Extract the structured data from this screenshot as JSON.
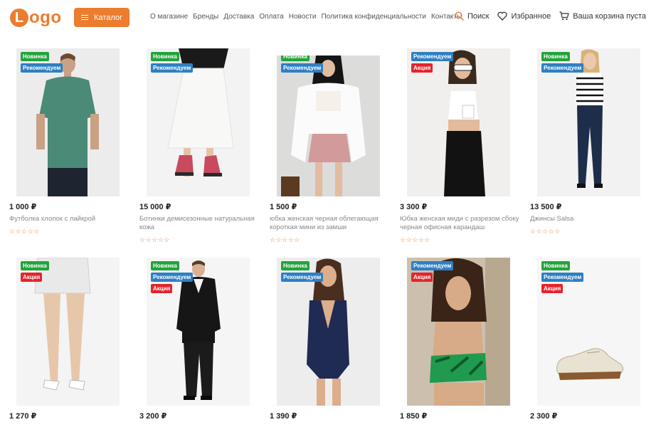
{
  "header": {
    "logo_letter": "L",
    "logo_rest": "ogo",
    "catalog_label": "Каталог",
    "nav": [
      "О магазине",
      "Бренды",
      "Доставка",
      "Оплата",
      "Новости",
      "Политика конфиденциальности",
      "Контакты"
    ],
    "search_label": "Поиск",
    "favorites_label": "Избранное",
    "cart_label": "Ваша корзина пуста"
  },
  "colors": {
    "accent": "#ec7c2e",
    "badge_new": "#22a33a",
    "badge_recommended": "#2e7fc4",
    "badge_sale": "#e5242b"
  },
  "rating_stars": "☆☆☆☆☆",
  "products": [
    {
      "price": "1 000 ₽",
      "name": "Футболка хлопок с лайкрой",
      "badges": [
        "Новинка",
        "Рекомендуем"
      ],
      "image": "man-green-tshirt"
    },
    {
      "price": "15 000 ₽",
      "name": "Ботинки демисезонные натуральная кожа",
      "badges": [
        "Новинка",
        "Рекомендуем"
      ],
      "image": "white-skirt-pink-boots"
    },
    {
      "price": "1 500 ₽",
      "name": "юбка женская черная облегающая короткая мини из замши",
      "badges": [
        "Новинка",
        "Рекомендуем"
      ],
      "image": "woman-white-blazer"
    },
    {
      "price": "3 300 ₽",
      "name": "Юбка женская миди с разрезом сбоку черная офисная карандаш",
      "badges": [
        "Рекомендуем",
        "Акция"
      ],
      "image": "woman-black-skirt"
    },
    {
      "price": "13 500 ₽",
      "name": "Джинсы Salsa",
      "badges": [
        "Новинка",
        "Рекомендуем"
      ],
      "image": "woman-jeans"
    },
    {
      "price": "1 270 ₽",
      "name": "",
      "badges": [
        "Новинка",
        "Акция"
      ],
      "image": "legs-white-heels"
    },
    {
      "price": "3 200 ₽",
      "name": "",
      "badges": [
        "Новинка",
        "Рекомендуем",
        "Акция"
      ],
      "image": "man-black-suit"
    },
    {
      "price": "1 390 ₽",
      "name": "",
      "badges": [
        "Новинка",
        "Рекомендуем"
      ],
      "image": "woman-navy-swimsuit"
    },
    {
      "price": "1 850 ₽",
      "name": "",
      "badges": [
        "Рекомендуем",
        "Акция"
      ],
      "image": "woman-green-top"
    },
    {
      "price": "2 300 ₽",
      "name": "",
      "badges": [
        "Новинка",
        "Рекомендуем",
        "Акция"
      ],
      "image": "beige-shoe"
    }
  ]
}
